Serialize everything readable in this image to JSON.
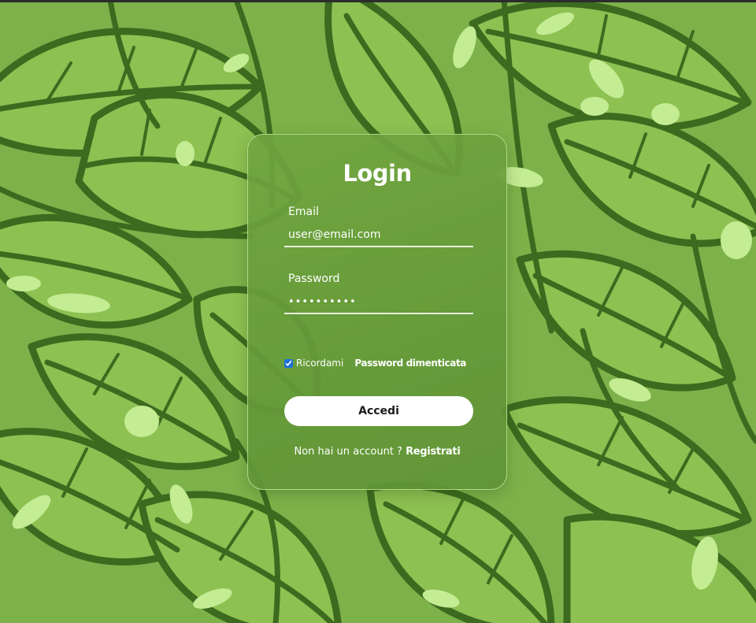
{
  "form": {
    "title": "Login",
    "email_label": "Email",
    "email_placeholder": "user@email.com",
    "password_label": "Password",
    "password_value": "••••••••••",
    "remember_label": "Ricordami",
    "remember_checked": true,
    "forgot_link": "Password dimenticata",
    "submit_label": "Accedi",
    "register_prompt": "Non hai un account ?",
    "register_link": "Registrati"
  },
  "colors": {
    "background_green": "#7db24a",
    "leaf_light": "#8dc152",
    "leaf_outline": "#3c6b1f",
    "highlight": "#c4ec93",
    "card_green": "#67a03b"
  }
}
